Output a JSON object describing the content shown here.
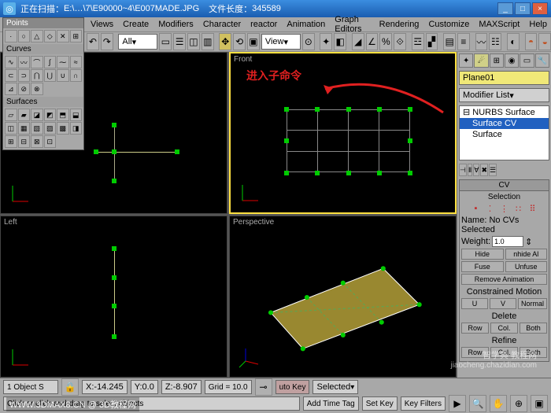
{
  "title": {
    "scanning": "正在扫描：",
    "path": "E:\\…\\7\\E90000~4\\E007MADE.JPG",
    "fsizelbl": "文件长度：",
    "fsize": "345589"
  },
  "menu": [
    "Views",
    "Create",
    "Modifiers",
    "Character",
    "reactor",
    "Animation",
    "Graph Editors",
    "Rendering",
    "Customize",
    "MAXScript",
    "Help"
  ],
  "toolbar": {
    "all": "All",
    "view": "View"
  },
  "floating": {
    "title": "Points",
    "curves": "Curves",
    "surfaces": "Surfaces"
  },
  "vp": {
    "tl": "",
    "tr": "Front",
    "bl": "Left",
    "br": "Perspective"
  },
  "annot": "进入子命令",
  "cmd": {
    "objname": "Plane01",
    "modlist": "Modifier List",
    "stack": [
      "NURBS Surface",
      "Surface CV",
      "Surface"
    ],
    "rollcv": "CV",
    "selection": "Selection",
    "namelbl": "Name:",
    "namesel": "No CVs Selected",
    "weightlbl": "Weight:",
    "weight": "1.0",
    "hide": "Hide",
    "unhide": "nhide Al",
    "fuse": "Fuse",
    "unfuse": "Unfuse",
    "removeani": "Remove Animation",
    "constrained": "Constrained Motion",
    "u": "U",
    "v": "V",
    "normal": "Normal",
    "delete": "Delete",
    "row": "Row",
    "col": "Col.",
    "both": "Both",
    "refine": "Refine"
  },
  "status": {
    "objcount": "1 Object S",
    "x": "X:",
    "xv": "-14.245",
    "y": "Y:",
    "yv": "0.0",
    "z": "Z:",
    "zv": "-8.907",
    "grid": "Grid = 10.0",
    "autokey": "uto Key",
    "selected": "Selected",
    "prompt": "Click or click-and-drag to select objects",
    "timetag": "Add Time Tag",
    "setkey": "Set Key",
    "keyfilters": "Key Filters"
  },
  "wm1": "智学典 教程网",
  "wm1b": "jiaocheng.chazidian.com",
  "wm2": "WWW.3DMAX8.CN @ 3D教程网"
}
